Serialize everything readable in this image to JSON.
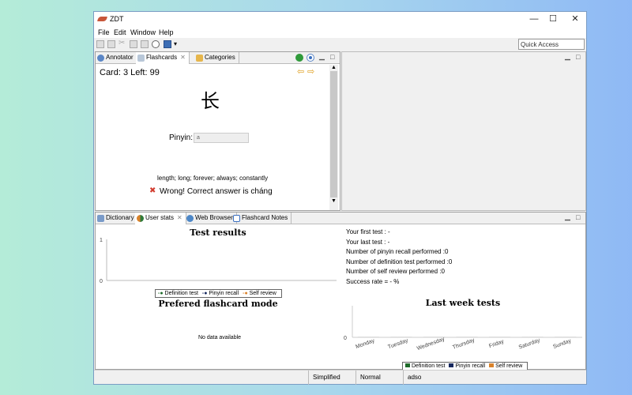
{
  "window": {
    "title": "ZDT",
    "controls": {
      "minimize": "—",
      "maximize": "☐",
      "close": "✕"
    }
  },
  "menu": [
    "File",
    "Edit",
    "Window",
    "Help"
  ],
  "toolbar": {
    "quick_access": "Quick Access"
  },
  "top_panel": {
    "tabs": [
      {
        "label": "Annotator"
      },
      {
        "label": "Flashcards",
        "close": "✕"
      },
      {
        "label": "Categories"
      }
    ],
    "card_status": "Card: 3 Left: 99",
    "character": "长",
    "pinyin_label": "Pinyin:",
    "pinyin_value": "a",
    "definition": "length; long; forever; always; constantly",
    "result": "Wrong! Correct answer is cháng",
    "result_icon": "✖"
  },
  "bottom_panel": {
    "tabs": [
      {
        "label": "Dictionary"
      },
      {
        "label": "User stats",
        "close": "✕"
      },
      {
        "label": "Web Browser"
      },
      {
        "label": "Flashcard Notes"
      }
    ],
    "stats": [
      "Your first test : -",
      "Your last test : -",
      "Number of pinyin recall performed :0",
      "Number of definition test performed :0",
      "Number of self review performed :0",
      "Success rate  = - %"
    ],
    "pie_title": "Prefered flashcard mode",
    "pie_empty": "No data available"
  },
  "chart_data": [
    {
      "type": "line",
      "title": "Test results",
      "x_ticks": [
        "0.0",
        "0.1",
        "0.2",
        "0.3",
        "0.4",
        "0.5",
        "0.6",
        "0.7",
        "0.8",
        "0.9",
        "1.0"
      ],
      "y_ticks": [
        "0",
        "1"
      ],
      "xlim": [
        0,
        1
      ],
      "ylim": [
        0,
        1
      ],
      "legend": [
        "Definition test",
        "Pinyin recall",
        "Self review"
      ],
      "legend_position": "bottom",
      "series": []
    },
    {
      "type": "bar",
      "title": "Last week tests",
      "categories": [
        "Monday",
        "Tuesday",
        "Wednesday",
        "Thursday",
        "Friday",
        "Saturday",
        "Sunday"
      ],
      "y_ticks": [
        "0"
      ],
      "series": [
        {
          "name": "Definition test",
          "values": [
            0,
            0,
            0,
            0,
            0,
            0,
            0
          ]
        },
        {
          "name": "Pinyin recall",
          "values": [
            0,
            0,
            0,
            0,
            0,
            0,
            0
          ]
        },
        {
          "name": "Self review",
          "values": [
            0,
            0,
            0,
            0,
            0,
            0,
            0
          ]
        }
      ],
      "legend_position": "bottom"
    }
  ],
  "colors": {
    "definition": "#1e6b2a",
    "pinyin": "#16285e",
    "self": "#d9822b"
  },
  "status_bar": [
    "Simplified",
    "Normal",
    "adso"
  ]
}
